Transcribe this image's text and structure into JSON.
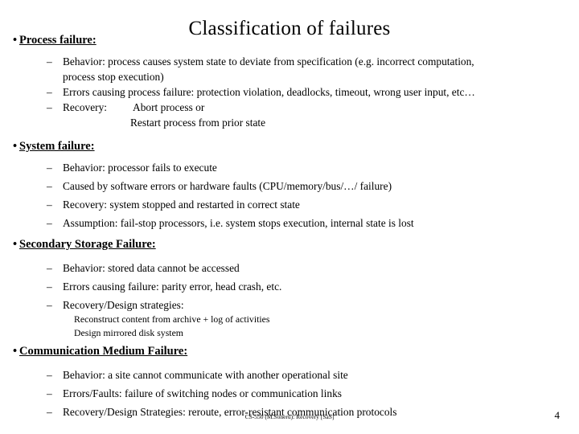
{
  "slide": {
    "title": "Classification of failures",
    "background_color": "#ffffff",
    "text_color": "#000000",
    "bullet_glyph": "•",
    "dash_glyph": "–"
  },
  "sections": [
    {
      "heading": "Process failure:",
      "items": [
        "Behavior: process causes system state to deviate from specification (e.g. incorrect computation, process stop execution)",
        "Errors causing process failure: protection violation, deadlocks, timeout, wrong user input, etc…",
        "Recovery:"
      ],
      "recovery_label": "Recovery:",
      "recovery_value_1": "Abort process or",
      "recovery_value_2": "Restart process from prior state",
      "wrap_line_1a": "Behavior: process causes system state to deviate from specification (e.g. incorrect computation,",
      "wrap_line_1b": "process stop execution)"
    },
    {
      "heading": "System failure:",
      "items": [
        "Behavior: processor fails to execute",
        "Caused by software errors or hardware faults (CPU/memory/bus/…/ failure)",
        "Recovery: system stopped and restarted in correct state",
        "Assumption: fail-stop processors, i.e. system stops execution, internal state is lost"
      ]
    },
    {
      "heading": "Secondary Storage Failure:",
      "items": [
        "Behavior: stored data cannot be accessed",
        "Errors causing failure: parity error, head crash, etc.",
        "Recovery/Design strategies:"
      ],
      "subitems": [
        "Reconstruct content from archive + log of activities",
        "Design mirrored disk system"
      ]
    },
    {
      "heading": "Communication Medium Failure:",
      "items": [
        "Behavior: a site cannot communicate with another operational site",
        "Errors/Faults: failure of switching nodes or communication links",
        "Recovery/Design Strategies: reroute, error-resistant communication protocols"
      ]
    }
  ],
  "footer": {
    "center": "CS-550 (M.Soneru): Recovery [SaS]",
    "page_number": "4"
  }
}
